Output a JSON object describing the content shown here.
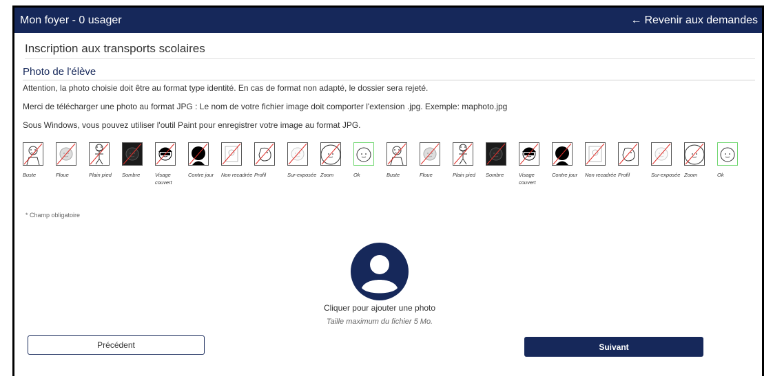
{
  "header": {
    "title": "Mon foyer - 0 usager",
    "back_label": "Revenir aux demandes"
  },
  "page": {
    "title": "Inscription aux transports scolaires",
    "section_title": "Photo de l'élève",
    "para1": "Attention, la photo choisie doit être au format type identité. En cas de format non adapté, le dossier sera rejeté.",
    "para2": "Merci de télécharger une photo au format JPG : Le nom de votre fichier image doit comporter l'extension .jpg. Exemple: maphoto.jpg",
    "para3": "Sous Windows, vous pouvez utiliser l'outil Paint pour enregistrer votre image au format JPG."
  },
  "examples": [
    {
      "label": "Buste",
      "kind": "buste"
    },
    {
      "label": "Floue",
      "kind": "floue"
    },
    {
      "label": "Plain pied",
      "kind": "plainpied"
    },
    {
      "label": "Sombre",
      "kind": "sombre"
    },
    {
      "label": "Visage couvert",
      "kind": "couvert"
    },
    {
      "label": "Contre jour",
      "kind": "contrejour"
    },
    {
      "label": "Non recadrée",
      "kind": "nonrecadree"
    },
    {
      "label": "Profil",
      "kind": "profil"
    },
    {
      "label": "Sur-exposée",
      "kind": "surexposee"
    },
    {
      "label": "Zoom",
      "kind": "zoom"
    },
    {
      "label": "Ok",
      "kind": "ok"
    },
    {
      "label": "Buste",
      "kind": "buste"
    },
    {
      "label": "Floue",
      "kind": "floue"
    },
    {
      "label": "Plain pied",
      "kind": "plainpied"
    },
    {
      "label": "Sombre",
      "kind": "sombre"
    },
    {
      "label": "Visage couvert",
      "kind": "couvert"
    },
    {
      "label": "Contre jour",
      "kind": "contrejour"
    },
    {
      "label": "Non recadrée",
      "kind": "nonrecadree"
    },
    {
      "label": "Profil",
      "kind": "profil"
    },
    {
      "label": "Sur-exposée",
      "kind": "surexposee"
    },
    {
      "label": "Zoom",
      "kind": "zoom"
    },
    {
      "label": "Ok",
      "kind": "ok"
    }
  ],
  "form": {
    "mandatory_note": "* Champ obligatoire",
    "upload_label": "Cliquer pour ajouter une photo",
    "upload_hint": "Taille maximum du fichier 5 Mo.",
    "prev_label": "Précédent",
    "next_label": "Suivant"
  },
  "colors": {
    "primary": "#16285a",
    "ok_border": "#6fd66f",
    "reject_border": "#555555",
    "reject_slash": "#e0302a"
  },
  "icons": {
    "back": "arrow-left-icon",
    "upload": "user-avatar-icon"
  }
}
